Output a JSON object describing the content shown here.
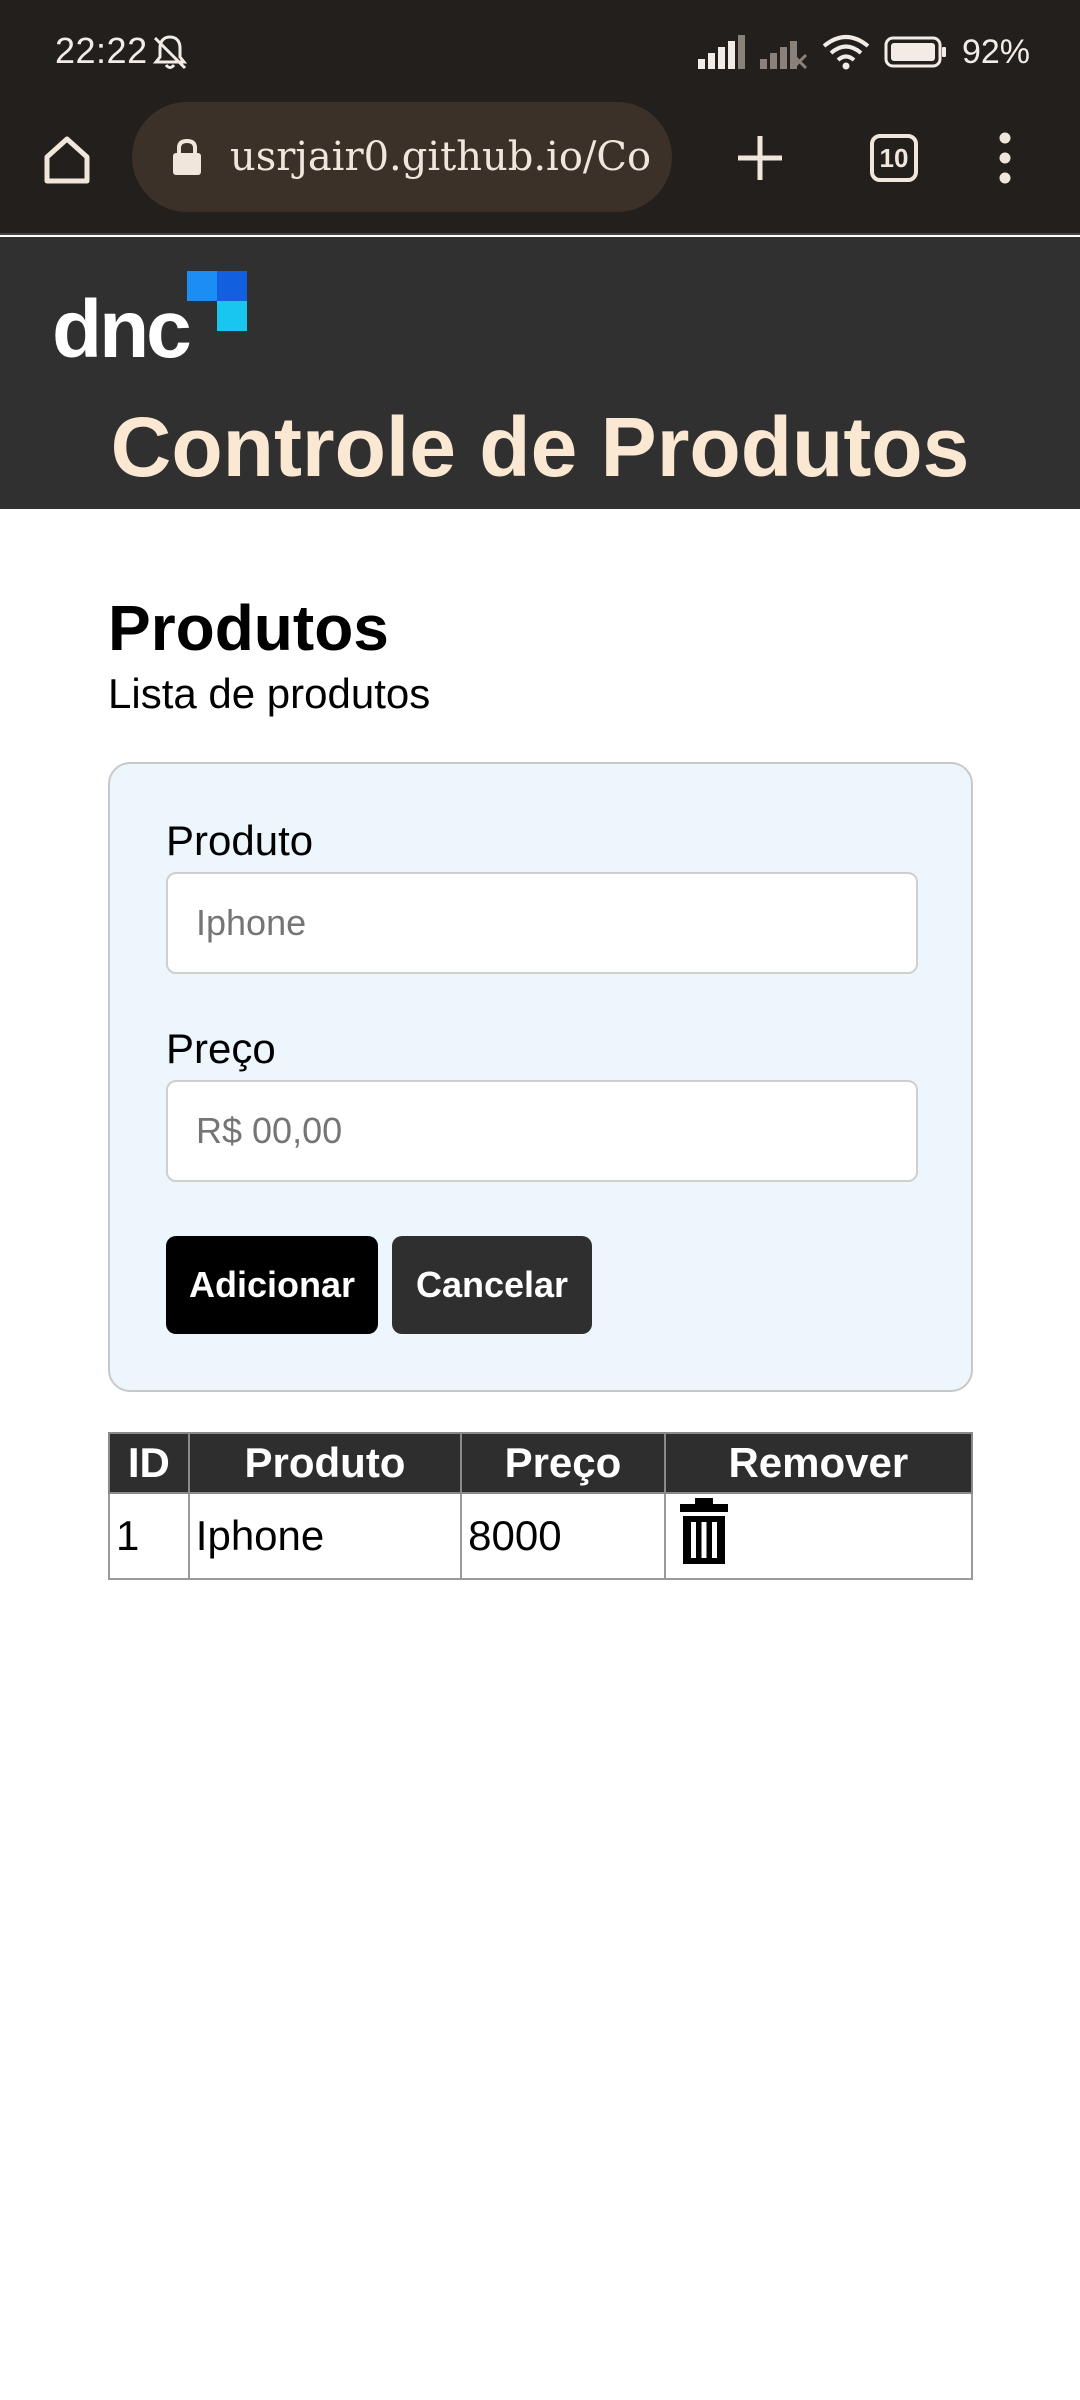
{
  "status_bar": {
    "time": "22:22",
    "battery": "92%",
    "icons": [
      "bell-off-icon",
      "signal-icon",
      "signal-no-service-icon",
      "wifi-icon",
      "battery-icon"
    ]
  },
  "browser": {
    "url": "usrjair0.github.io/Co",
    "tab_count": "10",
    "icons": [
      "home-icon",
      "lock-icon",
      "plus-icon",
      "tabs-icon",
      "more-vert-icon"
    ]
  },
  "header": {
    "logo_text": "dnc",
    "title": "Controle de Produtos",
    "colors": {
      "background": "#303030",
      "title": "#fbe8d3",
      "logo_blue": "#1b8df5",
      "logo_cyan": "#19c6ee"
    }
  },
  "main": {
    "title": "Produtos",
    "subtitle": "Lista de produtos"
  },
  "form": {
    "product_label": "Produto",
    "product_placeholder": "Iphone",
    "product_value": "",
    "price_label": "Preço",
    "price_placeholder": "R$ 00,00",
    "price_value": "",
    "add_button": "Adicionar",
    "cancel_button": "Cancelar"
  },
  "table": {
    "headers": [
      "ID",
      "Produto",
      "Preço",
      "Remover"
    ],
    "rows": [
      {
        "id": "1",
        "produto": "Iphone",
        "preco": "8000",
        "remove_icon": "trash-icon"
      }
    ]
  }
}
